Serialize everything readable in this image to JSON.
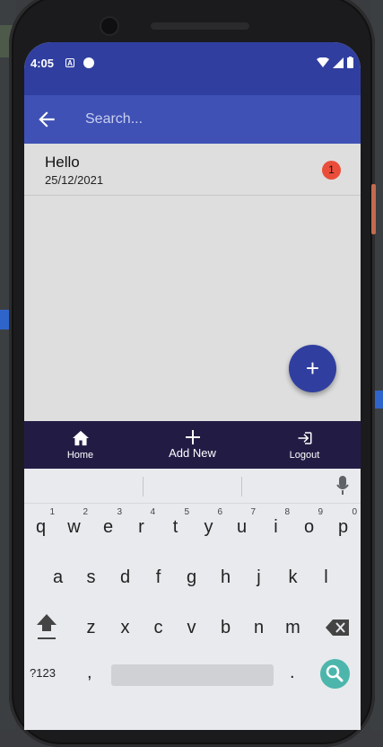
{
  "status": {
    "time": "4:05",
    "app_icon_letter": "A"
  },
  "search": {
    "placeholder": "Search..."
  },
  "list": [
    {
      "title": "Hello",
      "date": "25/12/2021",
      "badge": "1"
    }
  ],
  "fab": {
    "label": "+"
  },
  "bottom_nav": [
    {
      "label": "Home",
      "icon": "home-icon"
    },
    {
      "label": "Add New",
      "icon": "plus-icon"
    },
    {
      "label": "Logout",
      "icon": "logout-icon"
    }
  ],
  "keyboard": {
    "row1": [
      "q",
      "w",
      "e",
      "r",
      "t",
      "y",
      "u",
      "i",
      "o",
      "p"
    ],
    "row1_hints": [
      "1",
      "2",
      "3",
      "4",
      "5",
      "6",
      "7",
      "8",
      "9",
      "0"
    ],
    "row2": [
      "a",
      "s",
      "d",
      "f",
      "g",
      "h",
      "j",
      "k",
      "l"
    ],
    "row3": [
      "z",
      "x",
      "c",
      "v",
      "b",
      "n",
      "m"
    ],
    "symbols": "?123",
    "comma": ",",
    "period": "."
  },
  "colors": {
    "status_bar": "#303f9f",
    "app_bar": "#3f51b5",
    "fab": "#303f9f",
    "bottom_nav": "#221c45",
    "badge": "#ea4e3a",
    "enter": "#4db6ac"
  }
}
